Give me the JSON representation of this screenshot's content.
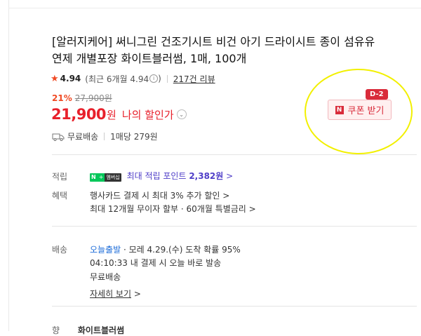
{
  "product": {
    "title": "[알러지케어] 써니그린 건조기시트 비건 아기 드라이시트 종이 섬유유연제 개별포장 화이트블러썸, 1매, 100개",
    "rating": "4.94",
    "recent_rating": "(최근 6개월 4.94",
    "recent_rating_close": ")",
    "review_count": "217건 리뷰",
    "discount_rate": "21%",
    "original_price": "27,900원",
    "price": "21,900",
    "price_unit": "원",
    "my_price_label": "나의 할인가",
    "shipping": "무료배송",
    "per_unit": "1매당 279원"
  },
  "coupon": {
    "badge": "D-2",
    "icon_letter": "N",
    "label": "쿠폰 받기"
  },
  "points": {
    "label": "적립",
    "npay_n": "N",
    "npay_plus": "+",
    "npay_text": "멤버십",
    "text": "최대 적립 포인트",
    "value": "2,382원",
    "chevron": ">"
  },
  "benefits": {
    "label": "혜택",
    "line1": "행사카드 결제 시 최대 3% 추가 할인",
    "line1_chevron": ">",
    "line2": "최대 12개월 무이자 할부 · 60개월 특별금리",
    "line2_chevron": ">"
  },
  "delivery": {
    "label": "배송",
    "today": "오늘출발",
    "arrival": "· 모레 4.29.(수) 도착 확률 95%",
    "cutoff": "04:10:33  내 결제 시 오늘 바로 발송",
    "fee": "무료배송",
    "details": "자세히 보기",
    "details_chevron": ">"
  },
  "bottom": {
    "label": "향",
    "value": "화이트블러썸"
  },
  "colors": {
    "accent_red": "#e8202b",
    "npay_green": "#03c75a",
    "point_purple": "#4f3ec8",
    "highlight_yellow": "#f2f000"
  }
}
